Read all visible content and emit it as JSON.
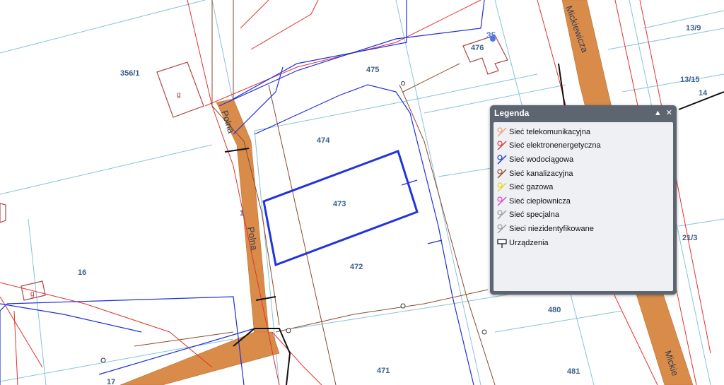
{
  "parcels": [
    {
      "label": "356/1"
    },
    {
      "label": "475"
    },
    {
      "label": "476"
    },
    {
      "label": "474"
    },
    {
      "label": "473"
    },
    {
      "label": "472"
    },
    {
      "label": "16"
    },
    {
      "label": "480"
    },
    {
      "label": "471"
    },
    {
      "label": "481"
    },
    {
      "label": "13/9"
    },
    {
      "label": "13/15"
    },
    {
      "label": "14"
    },
    {
      "label": "21/3"
    },
    {
      "label": "17"
    },
    {
      "label": "1"
    }
  ],
  "streets": [
    {
      "label": "Polna"
    },
    {
      "label": "Polna"
    },
    {
      "label": "Mickiewicza"
    },
    {
      "label": "Mickie"
    }
  ],
  "buildings": [
    {
      "label": "g"
    },
    {
      "label": "g"
    }
  ],
  "house_number": "35",
  "legend": {
    "title": "Legenda",
    "collapse_icon": "triangle-up-icon",
    "close_icon": "close-icon",
    "items": [
      {
        "label": "Sieć telekomunikacyjna",
        "color": "#f0a070"
      },
      {
        "label": "Sieć elektronenergetyczna",
        "color": "#e53030"
      },
      {
        "label": "Sieć wodociągowa",
        "color": "#1f2fe0"
      },
      {
        "label": "Sieć kanalizacyjna",
        "color": "#8b4a2b"
      },
      {
        "label": "Sieć gazowa",
        "color": "#e6d21a"
      },
      {
        "label": "Sieć ciepłownicza",
        "color": "#e040c8"
      },
      {
        "label": "Sieć specjalna",
        "color": "#9a9a9a"
      },
      {
        "label": "Sieci niezidentyfikowane",
        "color": "#9a9a9a"
      },
      {
        "label": "Urządzenia",
        "icon": "device-sign-icon"
      }
    ]
  },
  "colors": {
    "parcel_boundary": "#86c3d8",
    "street_fill": "#d98c4a",
    "water": "#1f2fe0",
    "electric": "#e53030",
    "sewer": "#8b4a2b",
    "highlight": "#2233dd"
  }
}
